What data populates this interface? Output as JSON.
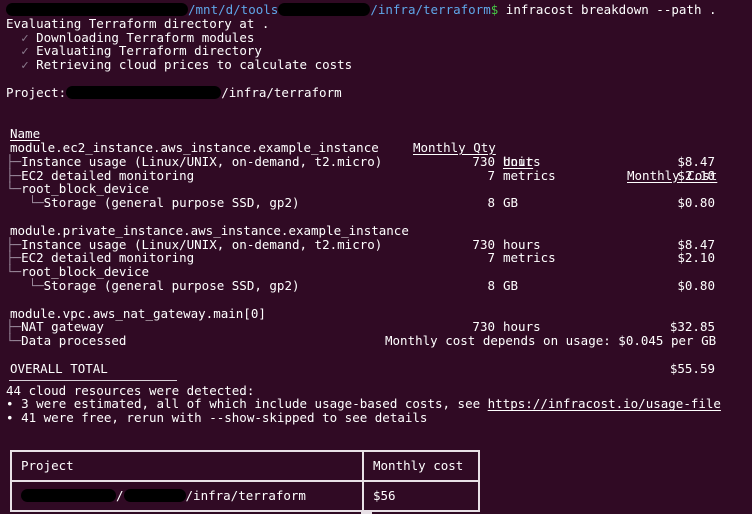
{
  "terminal": {
    "background_color": "#300a24",
    "foreground_color": "#ffffff",
    "path_color": "#5fa6e8",
    "prompt_symbol_color": "#46c946",
    "check_color": "#8a7a8c"
  },
  "prompt": {
    "path_prefix": "/mnt/d/tools",
    "path_suffix": "/infra/terraform",
    "symbol": "$",
    "command": "infracost breakdown --path ."
  },
  "progress": {
    "heading": "Evaluating Terraform directory at .",
    "check_glyph": "✓",
    "steps": [
      "Downloading Terraform modules",
      "Evaluating Terraform directory",
      "Retrieving cloud prices to calculate costs"
    ]
  },
  "project": {
    "label": "Project:",
    "path_suffix": "/infra/terraform"
  },
  "table": {
    "headers": {
      "name": "Name",
      "qty": "Monthly Qty",
      "unit": "Unit",
      "cost": "Monthly Cost"
    },
    "groups": [
      {
        "name": "module.ec2_instance.aws_instance.example_instance",
        "rows": [
          {
            "tree": "├─",
            "indent": 0,
            "label": "Instance usage (Linux/UNIX, on-demand, t2.micro)",
            "qty": "730",
            "unit": "hours",
            "cost": "$8.47"
          },
          {
            "tree": "├─",
            "indent": 0,
            "label": "EC2 detailed monitoring",
            "qty": "7",
            "unit": "metrics",
            "cost": "$2.10"
          },
          {
            "tree": "└─",
            "indent": 0,
            "label": "root_block_device",
            "qty": "",
            "unit": "",
            "cost": ""
          },
          {
            "tree": "└─",
            "indent": 1,
            "label": "Storage (general purpose SSD, gp2)",
            "qty": "8",
            "unit": "GB",
            "cost": "$0.80"
          }
        ]
      },
      {
        "name": "module.private_instance.aws_instance.example_instance",
        "rows": [
          {
            "tree": "├─",
            "indent": 0,
            "label": "Instance usage (Linux/UNIX, on-demand, t2.micro)",
            "qty": "730",
            "unit": "hours",
            "cost": "$8.47"
          },
          {
            "tree": "├─",
            "indent": 0,
            "label": "EC2 detailed monitoring",
            "qty": "7",
            "unit": "metrics",
            "cost": "$2.10"
          },
          {
            "tree": "└─",
            "indent": 0,
            "label": "root_block_device",
            "qty": "",
            "unit": "",
            "cost": ""
          },
          {
            "tree": "└─",
            "indent": 1,
            "label": "Storage (general purpose SSD, gp2)",
            "qty": "8",
            "unit": "GB",
            "cost": "$0.80"
          }
        ]
      },
      {
        "name": "module.vpc.aws_nat_gateway.main[0]",
        "rows": [
          {
            "tree": "├─",
            "indent": 0,
            "label": "NAT gateway",
            "qty": "730",
            "unit": "hours",
            "cost": "$32.85"
          },
          {
            "tree": "└─",
            "indent": 0,
            "label": "Data processed",
            "note": "Monthly cost depends on usage: $0.045 per GB",
            "qty": "",
            "unit": "",
            "cost": ""
          }
        ]
      }
    ],
    "total_label": "OVERALL TOTAL",
    "total_value": "$55.59"
  },
  "summary": {
    "detected": "44 cloud resources were detected:",
    "bullets": [
      {
        "marker": "∙",
        "text_before": "3 were estimated, all of which include usage-based costs, see ",
        "link": "https://infracost.io/usage-file",
        "text_after": ""
      },
      {
        "marker": "∙",
        "text_before": "41 were free, rerun with --show-skipped to see details",
        "link": "",
        "text_after": ""
      }
    ]
  },
  "summary_table": {
    "header_project": "Project",
    "header_cost": "Monthly cost",
    "row_project_suffix": "/infra/terraform",
    "row_project_separator": "/",
    "row_cost": "$56"
  }
}
